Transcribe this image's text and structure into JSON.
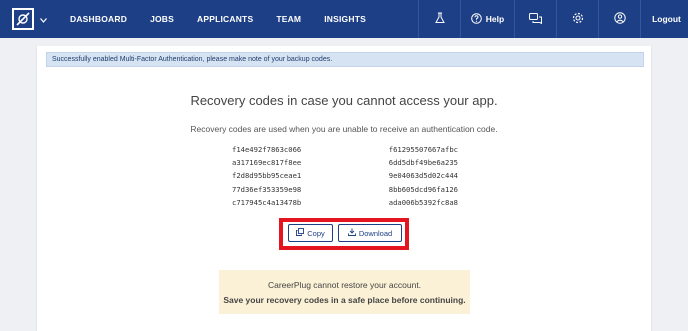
{
  "nav": {
    "links": [
      "DASHBOARD",
      "JOBS",
      "APPLICANTS",
      "TEAM",
      "INSIGHTS"
    ],
    "help_label": "Help",
    "logout_label": "Logout",
    "icons": [
      "flask-icon",
      "help-icon",
      "chat-icon",
      "gear-icon",
      "user-icon"
    ]
  },
  "alert": {
    "message": "Successfully enabled Multi-Factor Authentication, please make note of your backup codes."
  },
  "recovery": {
    "title": "Recovery codes in case you cannot access your app.",
    "description": "Recovery codes are used when you are unable to receive an authentication code.",
    "codes_left": [
      "f14e492f7863c066",
      "a317169ec817f8ee",
      "f2d8d95bb95ceae1",
      "77d36ef353359e98",
      "c717945c4a13478b"
    ],
    "codes_right": [
      "f61295507667afbc",
      "6dd5dbf49be6a235",
      "9e04063d5d02c444",
      "8bb605dcd96fa126",
      "ada006b5392fc8a8"
    ],
    "copy_label": "Copy",
    "download_label": "Download"
  },
  "warning": {
    "line1": "CareerPlug cannot restore your account.",
    "line2": "Save your recovery codes in a safe place before continuing."
  },
  "colors": {
    "nav_bg": "#1d3f85",
    "highlight": "#e4151f",
    "alert_bg": "#d6e3f2",
    "warning_bg": "#fbf1d6"
  }
}
